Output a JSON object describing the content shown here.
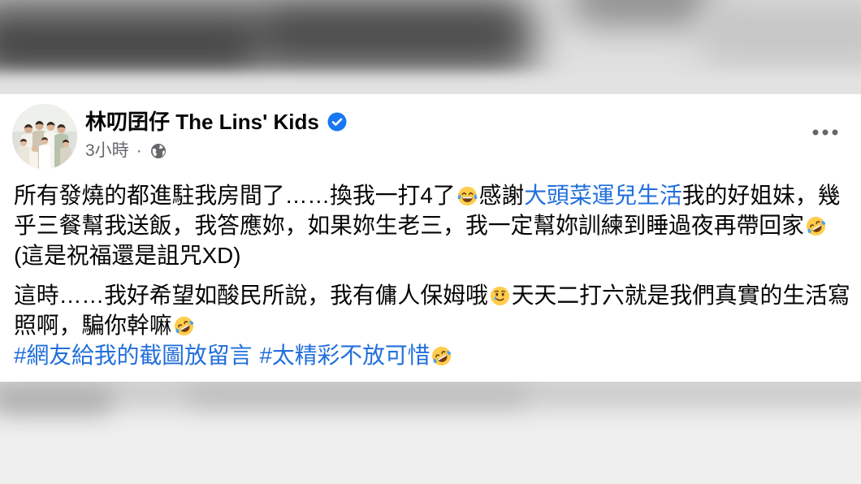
{
  "post": {
    "author": {
      "name": "林叨囝仔 The Lins' Kids",
      "verified_icon": "verified-badge-icon"
    },
    "meta": {
      "time": "3小時",
      "separator": "·",
      "audience_icon": "globe-icon"
    },
    "more_icon": "more-options-icon",
    "paragraphs": [
      {
        "lines": [
          {
            "segments": [
              {
                "text": "所有發燒的都進駐我房間了……換我一打4了"
              },
              {
                "emoji": "face-with-tears-of-joy-icon"
              },
              {
                "text": "感謝"
              },
              {
                "link": "大頭菜運兒生活"
              },
              {
                "text": "我的好姐妹，幾"
              }
            ]
          },
          {
            "segments": [
              {
                "text": "乎三餐幫我送飯，我答應妳，如果妳生老三，我一定幫妳訓練到睡過夜再帶回家"
              },
              {
                "emoji": "rolling-on-the-floor-laughing-icon"
              }
            ]
          },
          {
            "segments": [
              {
                "text": "(這是祝福還是詛咒XD)"
              }
            ]
          }
        ]
      },
      {
        "lines": [
          {
            "segments": [
              {
                "text": "這時……我好希望如酸民所說，我有傭人保姆哦"
              },
              {
                "emoji": "smiling-face-with-tear-icon"
              },
              {
                "text": "天天二打六就是我們真實的生活寫"
              }
            ]
          },
          {
            "segments": [
              {
                "text": "照啊，騙你幹嘛"
              },
              {
                "emoji": "rolling-on-the-floor-laughing-icon"
              }
            ]
          },
          {
            "segments": [
              {
                "hashtag": "#網友給我的截圖放留言"
              },
              {
                "hashtag": "#太精彩不放可惜"
              },
              {
                "emoji": "rolling-on-the-floor-laughing-icon"
              }
            ]
          }
        ]
      }
    ]
  },
  "colors": {
    "text": "#050505",
    "secondary_text": "#65676b",
    "link": "#216fdb",
    "verified_badge": "#1877f2",
    "emoji_yellow": "#ffcc4d",
    "emoji_tear": "#4aa3ea"
  }
}
